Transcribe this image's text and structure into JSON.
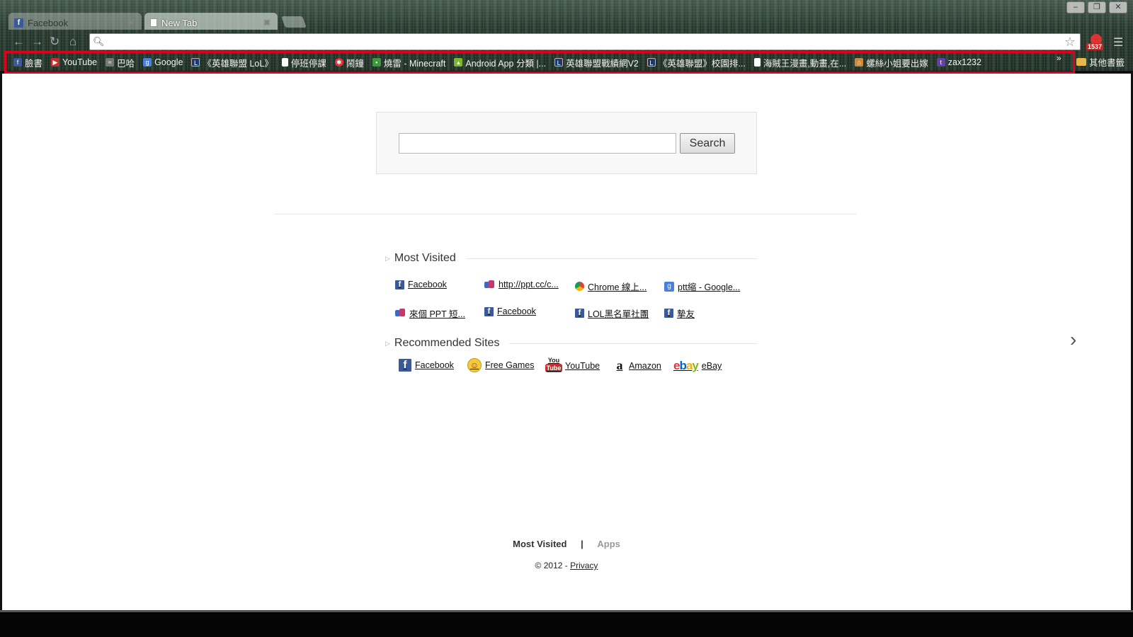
{
  "tabs": [
    {
      "label": "Facebook",
      "icon": "facebook-icon"
    },
    {
      "label": "New Tab",
      "icon": "page-icon"
    }
  ],
  "omnibox": {
    "value": "",
    "placeholder": ""
  },
  "extension": {
    "badge": "1537"
  },
  "bookmarks": [
    {
      "label": "臉書",
      "icon": "facebook-icon"
    },
    {
      "label": "YouTube",
      "icon": "youtube-icon"
    },
    {
      "label": "巴哈",
      "icon": "gamer-icon"
    },
    {
      "label": "Google",
      "icon": "google-icon"
    },
    {
      "label": "《英雄聯盟 LoL》",
      "icon": "lol-icon"
    },
    {
      "label": "停班停課",
      "icon": "page-icon"
    },
    {
      "label": "鬧鐘",
      "icon": "alarm-icon"
    },
    {
      "label": "燒雷 - Minecraft",
      "icon": "minecraft-icon"
    },
    {
      "label": "Android App 分類 |...",
      "icon": "android-icon"
    },
    {
      "label": "英雄聯盟戰績網V2",
      "icon": "lol-icon"
    },
    {
      "label": "《英雄聯盟》校園排...",
      "icon": "lol-icon"
    },
    {
      "label": "海賊王漫畫,動畫,在...",
      "icon": "page-icon"
    },
    {
      "label": "螺絲小姐要出嫁",
      "icon": "house-icon"
    },
    {
      "label": "zax1232",
      "icon": "twitch-icon"
    }
  ],
  "other_bookmarks": "其他書籤",
  "search": {
    "button_label": "Search",
    "value": ""
  },
  "most_visited": {
    "title": "Most Visited",
    "items": [
      {
        "label": "Facebook",
        "icon": "facebook-icon"
      },
      {
        "label": "http://ppt.cc/c...",
        "icon": "ppt-icon"
      },
      {
        "label": "Chrome 線上...",
        "icon": "chrome-icon"
      },
      {
        "label": "ptt縮 - Google...",
        "icon": "google-icon"
      },
      {
        "label": "來個 PPT 短...",
        "icon": "ppt-icon"
      },
      {
        "label": "Facebook",
        "icon": "facebook-icon"
      },
      {
        "label": "LOL黑名單社團",
        "icon": "facebook-icon"
      },
      {
        "label": "摯友",
        "icon": "facebook-icon"
      }
    ]
  },
  "recommended": {
    "title": "Recommended Sites",
    "items": [
      {
        "label": "Facebook",
        "icon": "facebook-icon"
      },
      {
        "label": "Free Games",
        "icon": "smiley-icon"
      },
      {
        "label": "YouTube",
        "icon": "youtube-icon"
      },
      {
        "label": "Amazon",
        "icon": "amazon-icon"
      },
      {
        "label": "eBay",
        "icon": "ebay-icon"
      }
    ]
  },
  "footer": {
    "most_visited": "Most Visited",
    "separator": "|",
    "apps": "Apps",
    "copyright_prefix": "© 2012 - ",
    "privacy": "Privacy"
  },
  "colors": {
    "bookmark_highlight": "#e0001a",
    "facebook": "#3b5998"
  }
}
